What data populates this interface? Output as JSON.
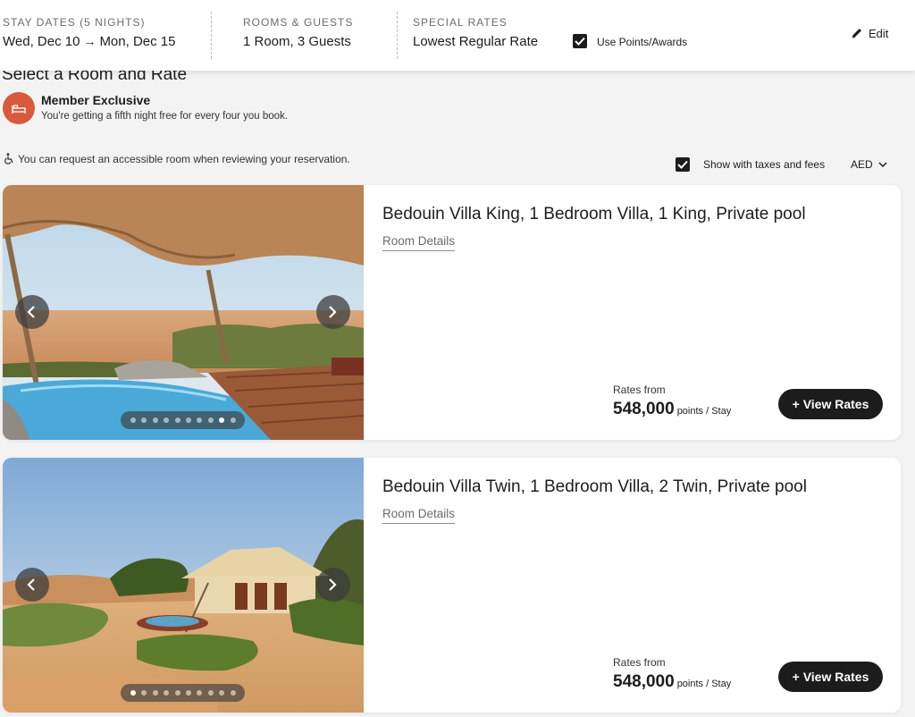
{
  "header": {
    "stay_label": "STAY DATES (5 NIGHTS)",
    "check_in": "Wed, Dec 10",
    "arrow": "→",
    "check_out": "Mon, Dec 15",
    "rooms_label": "ROOMS & GUESTS",
    "rooms_value": "1 Room, 3 Guests",
    "rates_label": "SPECIAL RATES",
    "rates_value": "Lowest Regular Rate",
    "points_label": "Use Points/Awards",
    "points_checked": true,
    "edit_label": "Edit"
  },
  "page": {
    "title": "Select a Room and Rate",
    "member_title": "Member Exclusive",
    "member_sub": "You're getting a fifth night free for every four you book.",
    "accessible_note": "You can request an accessible room when reviewing your reservation.",
    "taxes_label": "Show with taxes and fees",
    "taxes_checked": true,
    "currency": "AED"
  },
  "rooms": [
    {
      "name": "Bedouin Villa King, 1 Bedroom Villa, 1 King, Private pool",
      "details_link": "Room Details",
      "rates_from": "Rates from",
      "price": "548,000",
      "price_unit": "points / Stay",
      "button": "+ View Rates",
      "photo_count": 10,
      "active_photo": 9
    },
    {
      "name": "Bedouin Villa Twin, 1 Bedroom Villa, 2 Twin, Private pool",
      "details_link": "Room Details",
      "rates_from": "Rates from",
      "price": "548,000",
      "price_unit": "points / Stay",
      "button": "+ View Rates",
      "photo_count": 10,
      "active_photo": 1
    }
  ],
  "colors": {
    "accent_dark": "#1c1c1c",
    "member_badge": "#d9593c",
    "page_bg": "#f3f3f3"
  }
}
